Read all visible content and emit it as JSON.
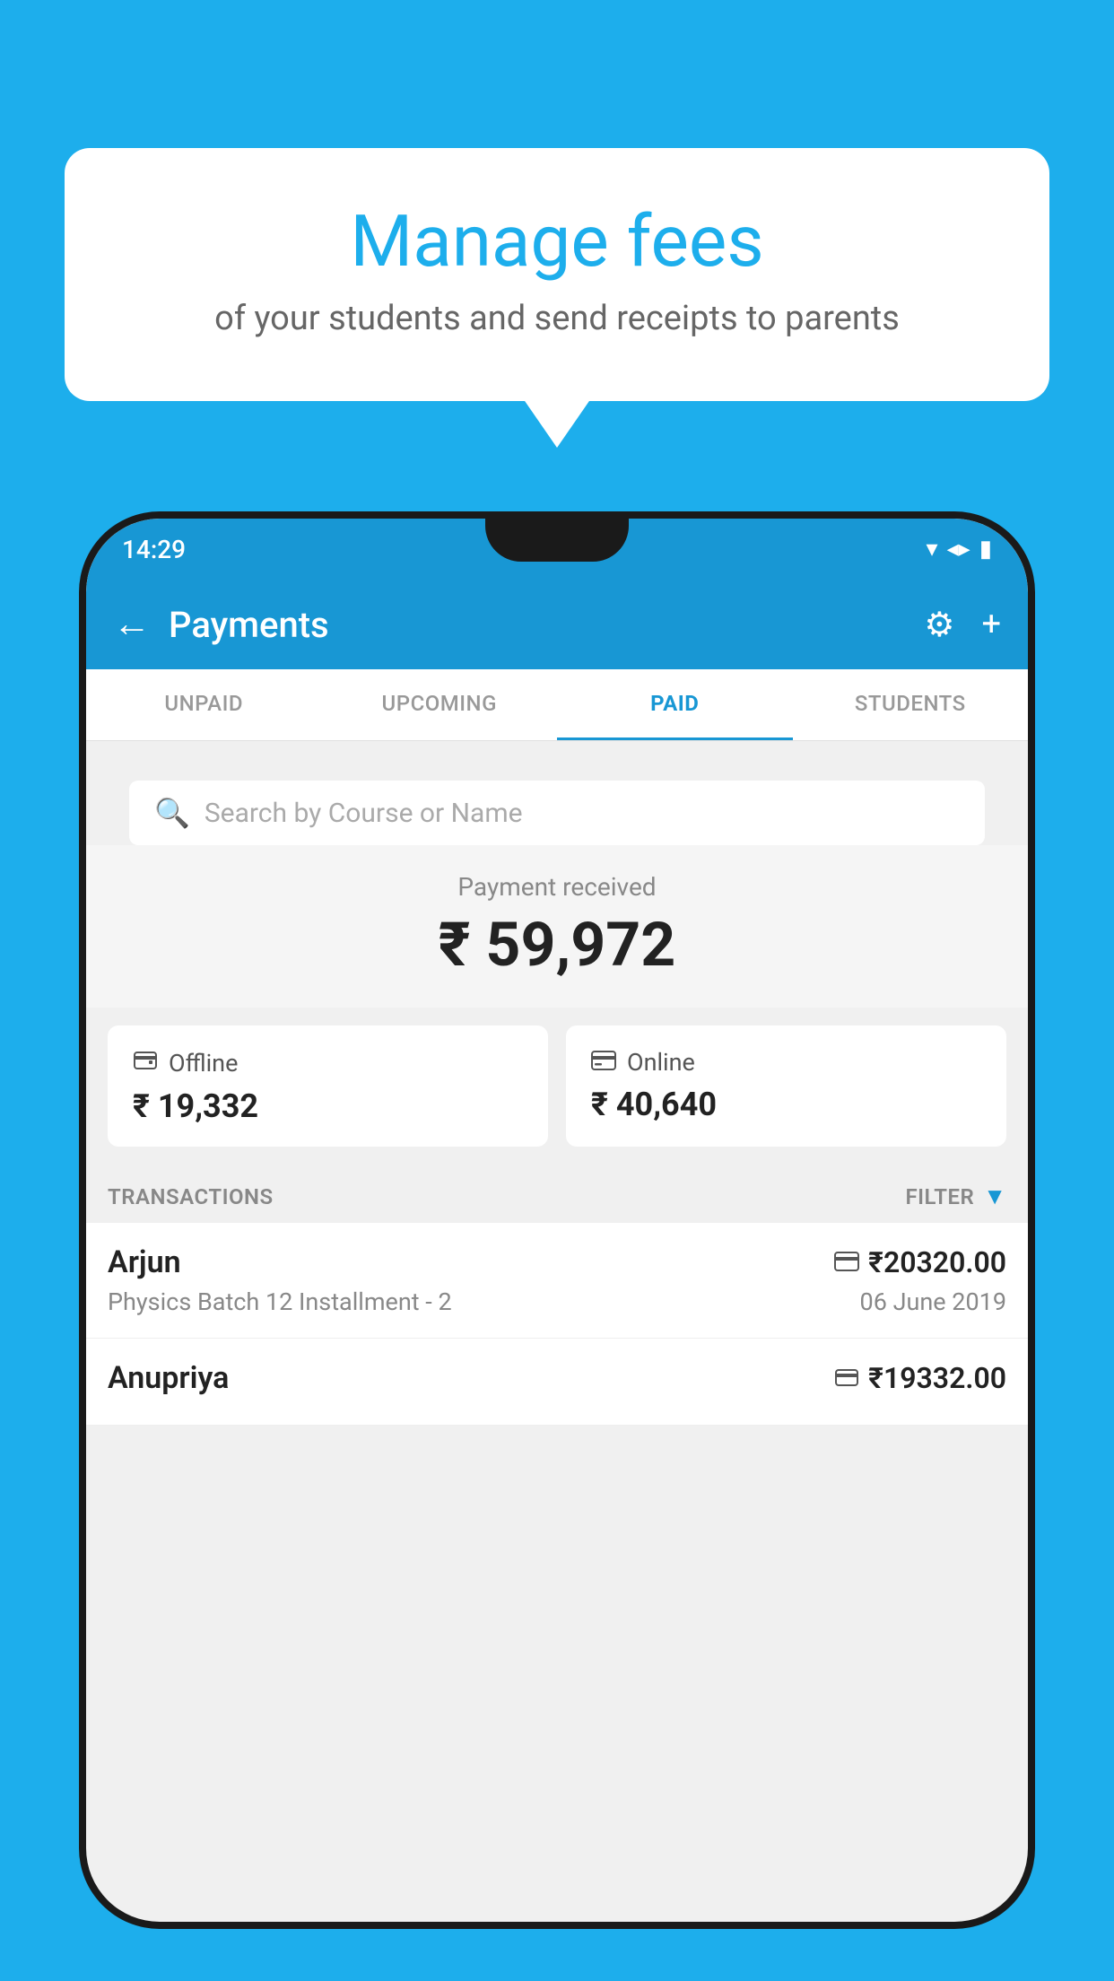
{
  "background_color": "#1DAEEC",
  "speech_bubble": {
    "title": "Manage fees",
    "subtitle": "of your students and send receipts to parents"
  },
  "status_bar": {
    "time": "14:29",
    "wifi": "▼",
    "signal": "▲",
    "battery": "▮"
  },
  "header": {
    "title": "Payments",
    "back_label": "←",
    "gear_label": "⚙",
    "plus_label": "+"
  },
  "tabs": [
    {
      "label": "UNPAID",
      "active": false
    },
    {
      "label": "UPCOMING",
      "active": false
    },
    {
      "label": "PAID",
      "active": true
    },
    {
      "label": "STUDENTS",
      "active": false
    }
  ],
  "search": {
    "placeholder": "Search by Course or Name"
  },
  "payment_received": {
    "label": "Payment received",
    "amount": "₹ 59,972"
  },
  "payment_cards": [
    {
      "icon": "💳",
      "label": "Offline",
      "amount": "₹ 19,332"
    },
    {
      "icon": "💳",
      "label": "Online",
      "amount": "₹ 40,640"
    }
  ],
  "transactions_label": "TRANSACTIONS",
  "filter_label": "FILTER",
  "transactions": [
    {
      "name": "Arjun",
      "type_icon": "💳",
      "amount": "₹20320.00",
      "course": "Physics Batch 12 Installment - 2",
      "date": "06 June 2019"
    },
    {
      "name": "Anupriya",
      "type_icon": "💵",
      "amount": "₹19332.00",
      "course": "",
      "date": ""
    }
  ]
}
